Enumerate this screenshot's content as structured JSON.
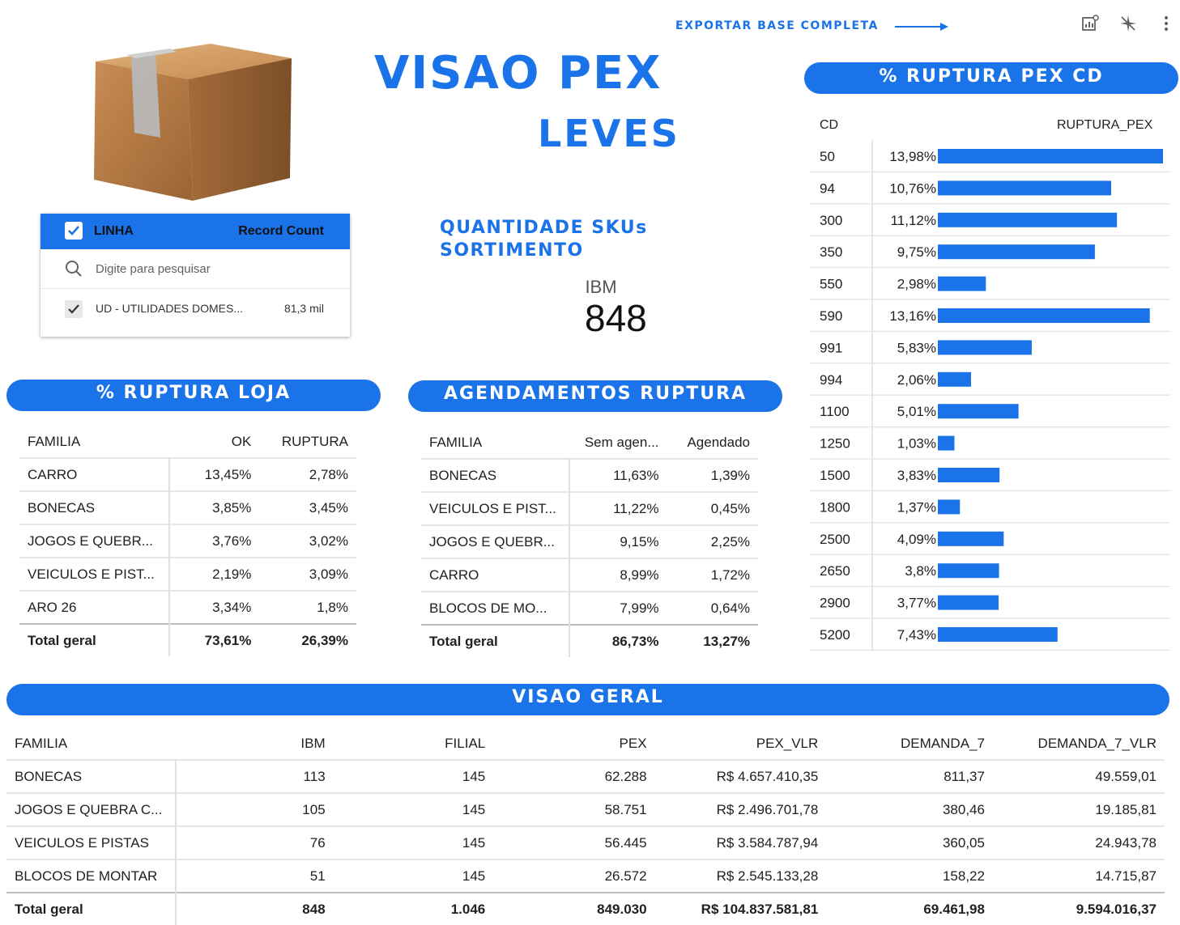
{
  "header": {
    "export_label": "EXPORTAR BASE COMPLETA",
    "title_main": "VISAO PEX",
    "title_sub": "LEVES",
    "icons": [
      "chart-config-icon",
      "sparkle-icon",
      "more-vert-icon"
    ]
  },
  "filter": {
    "header_dimension": "LINHA",
    "header_metric": "Record Count",
    "search_placeholder": "Digite para pesquisar",
    "item_label": "UD - UTILIDADES DOMES...",
    "item_value": "81,3 mil"
  },
  "scorecard": {
    "title_line1": "QUANTIDADE SKUs",
    "title_line2": "SORTIMENTO",
    "label": "IBM",
    "value": "848"
  },
  "ruptura_cd": {
    "title": "% RUPTURA PEX CD",
    "col_cd": "CD",
    "col_metric": "RUPTURA_PEX"
  },
  "chart_data": {
    "type": "bar",
    "orientation": "horizontal",
    "categories": [
      "50",
      "94",
      "300",
      "350",
      "550",
      "590",
      "991",
      "994",
      "1100",
      "1250",
      "1500",
      "1800",
      "2500",
      "2650",
      "2900",
      "5200"
    ],
    "values": [
      13.98,
      10.76,
      11.12,
      9.75,
      2.98,
      13.16,
      5.83,
      2.06,
      5.01,
      1.03,
      3.83,
      1.37,
      4.09,
      3.8,
      3.77,
      7.43
    ],
    "labels": [
      "13,98%",
      "10,76%",
      "11,12%",
      "9,75%",
      "2,98%",
      "13,16%",
      "5,83%",
      "2,06%",
      "5,01%",
      "1,03%",
      "3,83%",
      "1,37%",
      "4,09%",
      "3,8%",
      "3,77%",
      "7,43%"
    ],
    "xlabel": "CD",
    "ylabel": "RUPTURA_PEX",
    "color": "#1a73e8"
  },
  "ruptura_loja": {
    "title": "% RUPTURA LOJA",
    "columns": [
      "FAMILIA",
      "OK",
      "RUPTURA"
    ],
    "rows": [
      [
        "CARRO",
        "13,45%",
        "2,78%"
      ],
      [
        "BONECAS",
        "3,85%",
        "3,45%"
      ],
      [
        "JOGOS E QUEBR...",
        "3,76%",
        "3,02%"
      ],
      [
        "VEICULOS E PIST...",
        "2,19%",
        "3,09%"
      ],
      [
        "ARO 26",
        "3,34%",
        "1,8%"
      ]
    ],
    "total": [
      "Total geral",
      "73,61%",
      "26,39%"
    ]
  },
  "agendamentos": {
    "title": "AGENDAMENTOS RUPTURA",
    "columns": [
      "FAMILIA",
      "Sem agen...",
      "Agendado"
    ],
    "rows": [
      [
        "BONECAS",
        "11,63%",
        "1,39%"
      ],
      [
        "VEICULOS E PIST...",
        "11,22%",
        "0,45%"
      ],
      [
        "JOGOS E QUEBR...",
        "9,15%",
        "2,25%"
      ],
      [
        "CARRO",
        "8,99%",
        "1,72%"
      ],
      [
        "BLOCOS DE MO...",
        "7,99%",
        "0,64%"
      ]
    ],
    "total": [
      "Total geral",
      "86,73%",
      "13,27%"
    ]
  },
  "visao_geral": {
    "title": "VISAO GERAL",
    "columns": [
      "FAMILIA",
      "IBM",
      "FILIAL",
      "PEX",
      "PEX_VLR",
      "DEMANDA_7",
      "DEMANDA_7_VLR"
    ],
    "rows": [
      [
        "BONECAS",
        "113",
        "145",
        "62.288",
        "R$ 4.657.410,35",
        "811,37",
        "49.559,01"
      ],
      [
        "JOGOS E QUEBRA C...",
        "105",
        "145",
        "58.751",
        "R$ 2.496.701,78",
        "380,46",
        "19.185,81"
      ],
      [
        "VEICULOS E PISTAS",
        "76",
        "145",
        "56.445",
        "R$ 3.584.787,94",
        "360,05",
        "24.943,78"
      ],
      [
        "BLOCOS DE MONTAR",
        "51",
        "145",
        "26.572",
        "R$ 2.545.133,28",
        "158,22",
        "14.715,87"
      ]
    ],
    "total": [
      "Total geral",
      "848",
      "1.046",
      "849.030",
      "R$ 104.837.581,81",
      "69.461,98",
      "9.594.016,37"
    ]
  },
  "colors": {
    "accent": "#1a73e8"
  }
}
